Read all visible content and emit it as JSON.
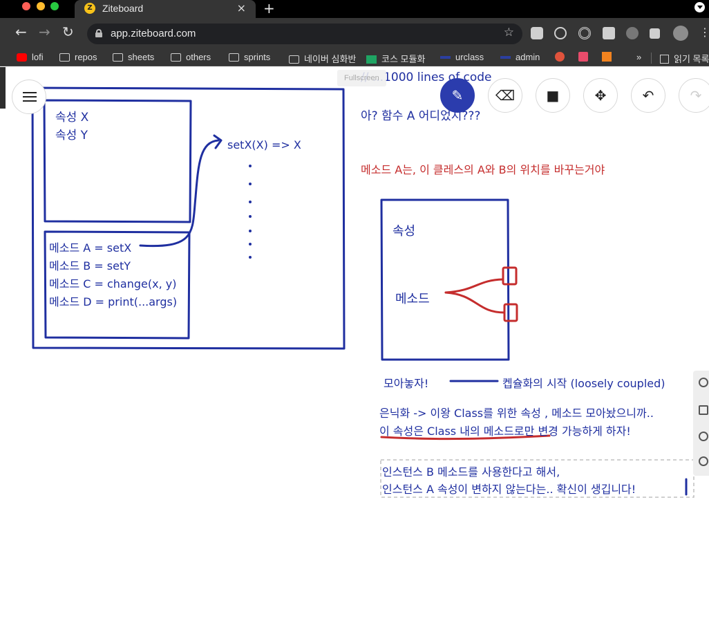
{
  "browser": {
    "tab_title": "Ziteboard",
    "tab_close": "×",
    "new_tab": "+",
    "url": "app.ziteboard.com",
    "bookmarks": [
      "lofi",
      "repos",
      "sheets",
      "others",
      "sprints",
      "네이버 심화반",
      "코스 모듈화",
      "urclass",
      "admin"
    ],
    "bookmarks_overflow": "»",
    "reading_list": "읽기 목록"
  },
  "tooltip": {
    "fullscreen": "Fullscreen"
  },
  "board": {
    "left_box_1": [
      "속성 X",
      "속성 Y"
    ],
    "left_box_2": [
      "메소드 A = setX",
      "메소드 B = setY",
      "메소드 C = change(x, y)",
      "메소드 D = print(...args)"
    ],
    "setx_label": "setX(X) => X",
    "code_note": "// ...1000 lines of code",
    "question": "아? 함수 A 어디었지???",
    "red_note": "메소드 A는, 이 클레스의 A와 B의 위치를 바꾸는거야",
    "diagram_attr": "속성",
    "diagram_method": "메소드",
    "gather": "모아놓자!",
    "encapsulation": "켑슐화의 시작 (loosely coupled)",
    "hiding_1": "은닉화 -> 이왕 Class를 위한 속성 , 메소드 모아놨으니까..",
    "hiding_2": "이 속성은 Class 내의 메소드로만 변경 가능하게 하자!",
    "selected_1": "인스턴스 B 메소드를 사용한다고 해서,",
    "selected_2": "인스턴스 A 속성이 변하지 않는다는.. 확신이 생깁니다!"
  },
  "colors": {
    "ink_blue": "#1f2fa0",
    "ink_red": "#c52d2d",
    "tool_active": "#2b3cad"
  }
}
